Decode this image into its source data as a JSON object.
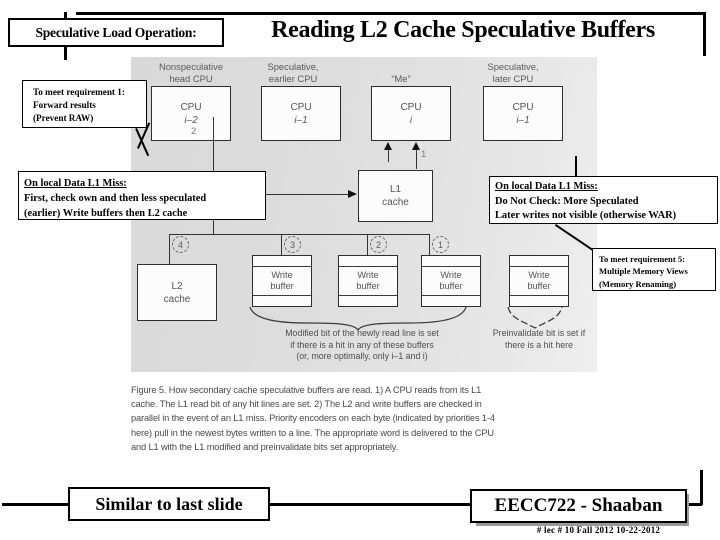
{
  "header": {
    "tag_label": "Speculative Load Operation:",
    "title": "Reading L2 Cache Speculative Buffers"
  },
  "figure": {
    "column_headers": [
      "Nonspeculative\nhead CPU",
      "Speculative,\nearlier CPU",
      "\"Me\"",
      "Speculative,\nlater CPU"
    ],
    "col_header_lines": [
      [
        "Nonspeculative",
        "head CPU"
      ],
      [
        "Speculative,",
        "earlier CPU"
      ],
      [
        "“Me”",
        ""
      ],
      [
        "Speculative,",
        "later CPU"
      ]
    ],
    "cpus": [
      {
        "name": "CPU",
        "index": "i–2"
      },
      {
        "name": "CPU",
        "index": "i–1"
      },
      {
        "name": "CPU",
        "index": "i"
      },
      {
        "name": "CPU",
        "index": "i–1"
      }
    ],
    "l1_cache": {
      "line1": "L1",
      "line2": "cache"
    },
    "l2_cache": {
      "line1": "L2",
      "line2": "cache"
    },
    "write_buffers": [
      {
        "line1": "Write",
        "line2": "buffer"
      },
      {
        "line1": "Write",
        "line2": "buffer"
      },
      {
        "line1": "Write",
        "line2": "buffer"
      },
      {
        "line1": "Write",
        "line2": "buffer"
      }
    ],
    "priority_numbers": [
      "4",
      "3",
      "2",
      "1"
    ],
    "step_labels": {
      "step1": "1",
      "step2": "2"
    },
    "note_left": [
      "Modified bit of the newly read line is set",
      "if there is a hit in any of these buffers",
      "(or, more optimally, only i–1 and i)"
    ],
    "note_right": [
      "Preinvalidate bit is set if",
      "there is a hit here"
    ],
    "caption": [
      "Figure 5. How secondary cache speculative buffers are read. 1) A CPU reads from its L1",
      "cache. The L1 read bit of any hit lines are set. 2) The L2 and write buffers are checked in",
      "parallel in the event of an L1 miss. Priority encoders on each byte (indicated by priorities 1-4",
      "here) pull in the newest bytes written to a line. The appropriate word is delivered to the CPU",
      "and L1 with the L1 modified and preinvalidate bits set appropriately."
    ]
  },
  "callouts": {
    "requirement1": {
      "lines": [
        "To meet requirement 1:",
        "Forward results",
        "(Prevent RAW)"
      ]
    },
    "local_l1_miss_left": {
      "heading": "On local Data L1 Miss:",
      "lines": [
        "First, check own and then less speculated",
        " (earlier) Write buffers then L2 cache"
      ]
    },
    "local_l1_miss_right": {
      "heading": "On local Data L1 Miss:",
      "lines": [
        "Do Not Check: More Speculated",
        " Later writes not visible (otherwise WAR)"
      ]
    },
    "requirement5": {
      "lines": [
        "To meet requirement 5:",
        "Multiple Memory Views",
        "(Memory Renaming)"
      ]
    }
  },
  "footer": {
    "left_label": "Similar to last slide",
    "right_label": "EECC722 - Shaaban",
    "meta": "#  lec # 10   Fall 2012   10-22-2012"
  },
  "colors": {
    "ink": "#000000",
    "figure_bg": "#dedede",
    "figure_ink": "#555555",
    "shadow": "#9a9a9a"
  }
}
